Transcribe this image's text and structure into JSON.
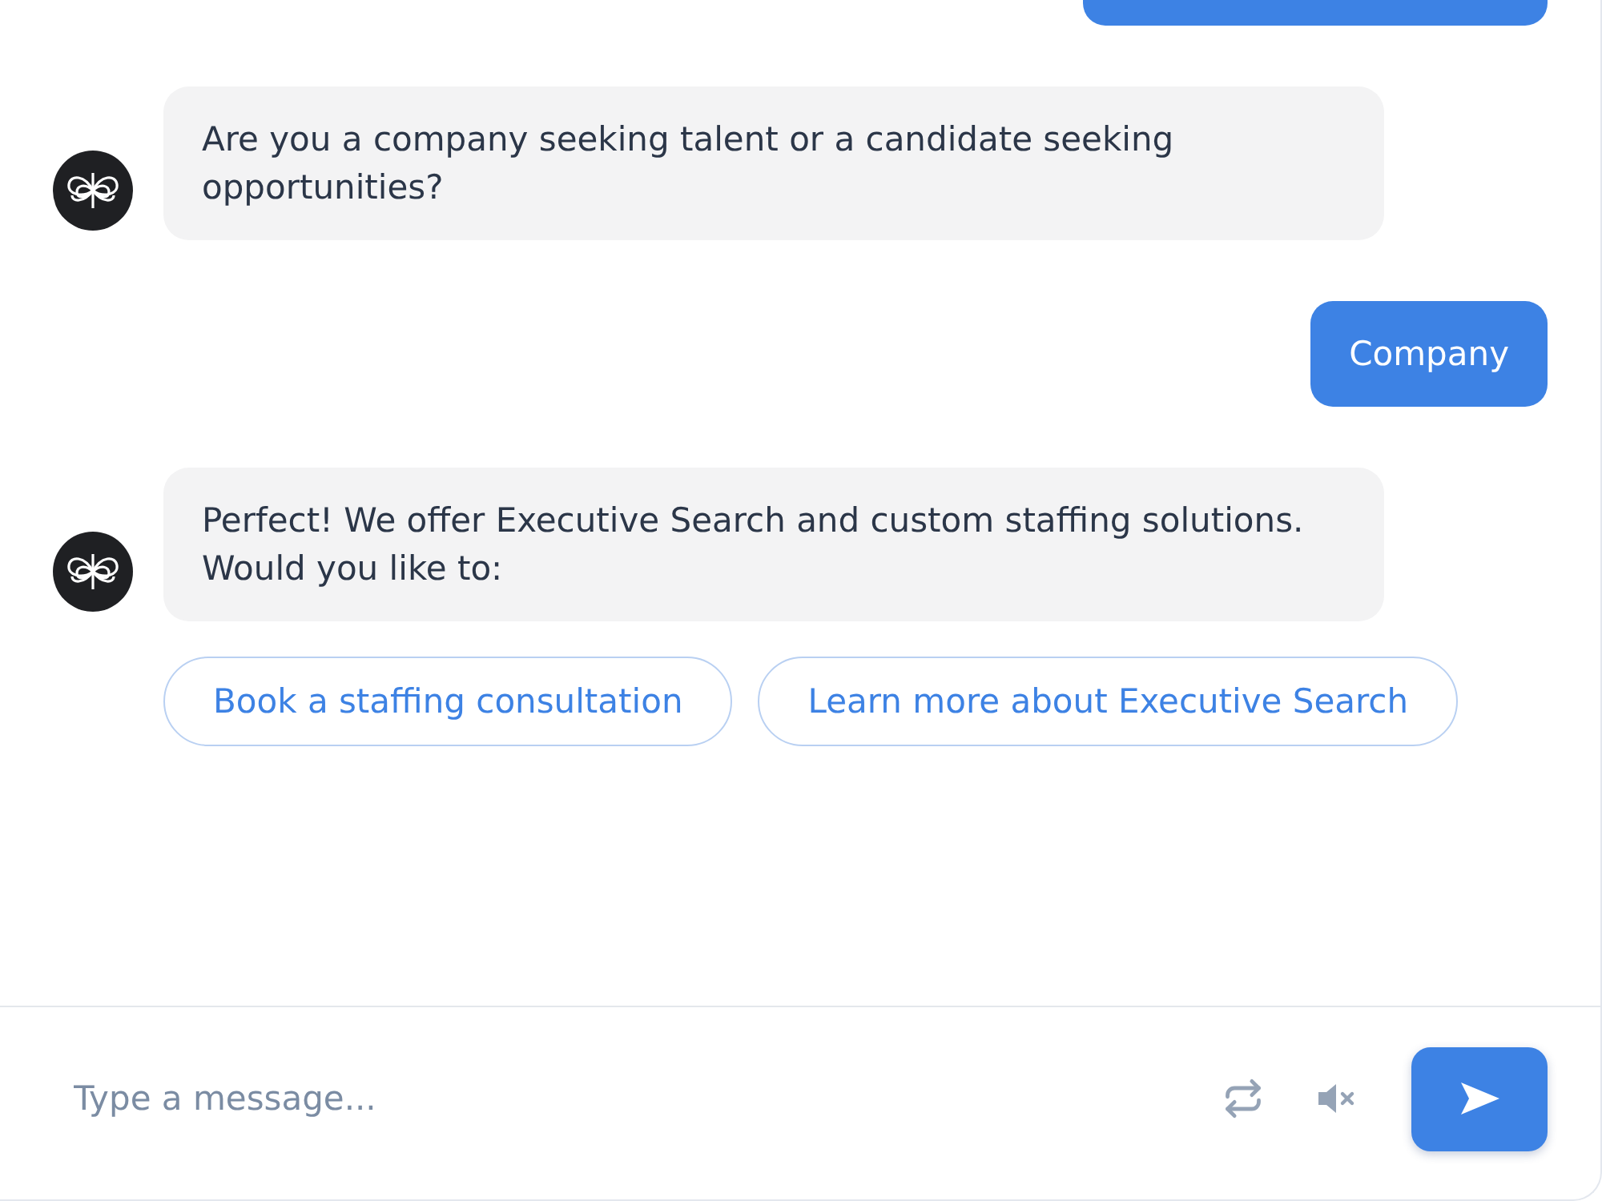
{
  "messages": [
    {
      "kind": "user"
    },
    {
      "kind": "bot",
      "text": "Are you a company seeking talent or a candidate seeking opportunities?"
    },
    {
      "kind": "user",
      "text": "Company"
    },
    {
      "kind": "bot",
      "text": "Perfect! We offer Executive Search and custom staffing solutions. Would you like to:",
      "options": [
        "Book a staffing consultation",
        "Learn more about Executive Search"
      ]
    }
  ],
  "composer": {
    "placeholder": "Type a message...",
    "muted": true
  }
}
